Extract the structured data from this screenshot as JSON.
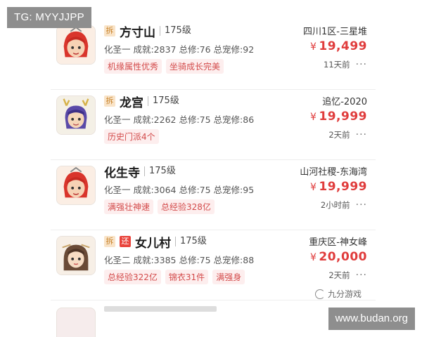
{
  "watermarks": {
    "top_left": "TG: MYYJJPP",
    "bottom_right": "www.budan.org",
    "brand": "九分游戏"
  },
  "listings": [
    {
      "tags": [
        "拆"
      ],
      "school": "方寸山",
      "level": "175级",
      "stats": "化圣一 成就:2837 总修:76 总宠修:92",
      "chips": [
        "机缘属性优秀",
        "坐骑成长完美"
      ],
      "server": "四川1区-三星堆",
      "currency": "¥",
      "price": "19,499",
      "time": "11天前",
      "more": "···"
    },
    {
      "tags": [
        "拆"
      ],
      "school": "龙宫",
      "level": "175级",
      "stats": "化圣一 成就:2262 总修:75 总宠修:86",
      "chips": [
        "历史门派4个"
      ],
      "server": "追忆-2020",
      "currency": "¥",
      "price": "19,999",
      "time": "2天前",
      "more": "···"
    },
    {
      "tags": [],
      "school": "化生寺",
      "level": "175级",
      "stats": "化圣一 成就:3064 总修:75 总宠修:95",
      "chips": [
        "满强壮神速",
        "总经验328亿"
      ],
      "server": "山河社稷-东海湾",
      "currency": "¥",
      "price": "19,999",
      "time": "2小时前",
      "more": "···"
    },
    {
      "tags": [
        "拆",
        "还"
      ],
      "school": "女儿村",
      "level": "175级",
      "stats": "化圣二 成就:3385 总修:75 总宠修:88",
      "chips": [
        "总经验322亿",
        "锦衣31件",
        "满强身"
      ],
      "server": "重庆区-神女峰",
      "currency": "¥",
      "price": "20,000",
      "time": "2天前",
      "more": "···"
    }
  ],
  "colors": {
    "price": "#e03c3c",
    "chip_text": "#d34b4b",
    "chip_bg": "#fdeeee",
    "tag_chai_bg": "#f9e4c9",
    "tag_huan_bg": "#e9443c"
  }
}
